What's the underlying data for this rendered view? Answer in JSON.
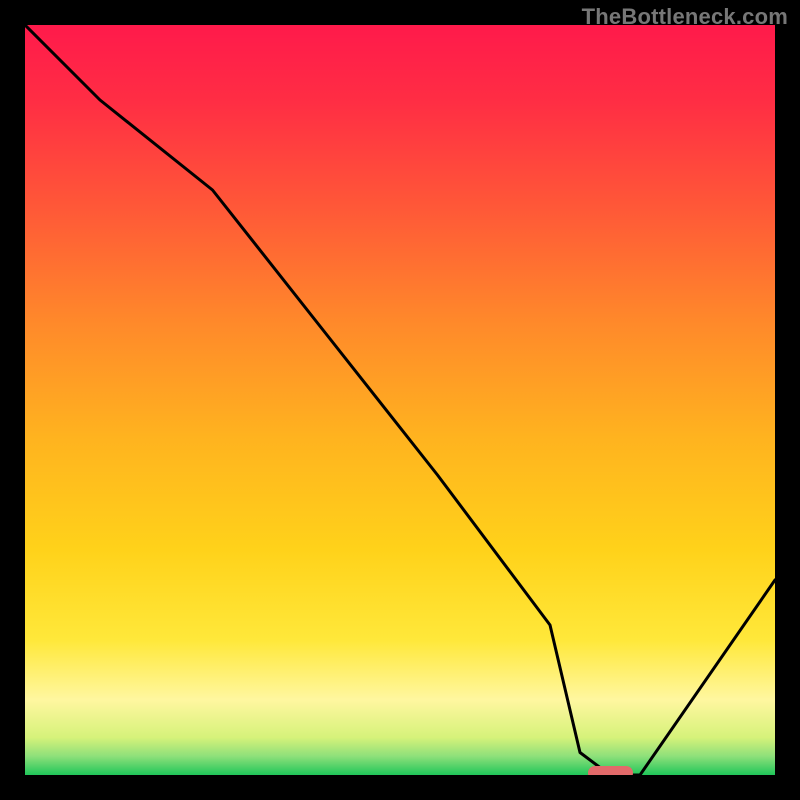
{
  "watermark": "TheBottleneck.com",
  "chart_data": {
    "type": "line",
    "title": "",
    "xlabel": "",
    "ylabel": "",
    "xlim": [
      0,
      100
    ],
    "ylim": [
      0,
      100
    ],
    "x": [
      0,
      10,
      25,
      40,
      55,
      70,
      74,
      78,
      82,
      100
    ],
    "values": [
      100,
      90,
      78,
      59,
      40,
      20,
      3,
      0,
      0,
      26
    ],
    "optimum_marker": {
      "x_start": 75,
      "x_end": 81,
      "y": 0
    },
    "background_gradient_stops": [
      {
        "offset": 0.0,
        "color": "#ff1a4b"
      },
      {
        "offset": 0.1,
        "color": "#ff2d44"
      },
      {
        "offset": 0.25,
        "color": "#ff5a37"
      },
      {
        "offset": 0.4,
        "color": "#ff8a2a"
      },
      {
        "offset": 0.55,
        "color": "#ffb31f"
      },
      {
        "offset": 0.7,
        "color": "#ffd21a"
      },
      {
        "offset": 0.82,
        "color": "#ffe83a"
      },
      {
        "offset": 0.9,
        "color": "#fff7a0"
      },
      {
        "offset": 0.95,
        "color": "#d6f27a"
      },
      {
        "offset": 0.975,
        "color": "#8ee07a"
      },
      {
        "offset": 1.0,
        "color": "#20c65a"
      }
    ],
    "line_color": "#000000",
    "line_width": 3
  }
}
